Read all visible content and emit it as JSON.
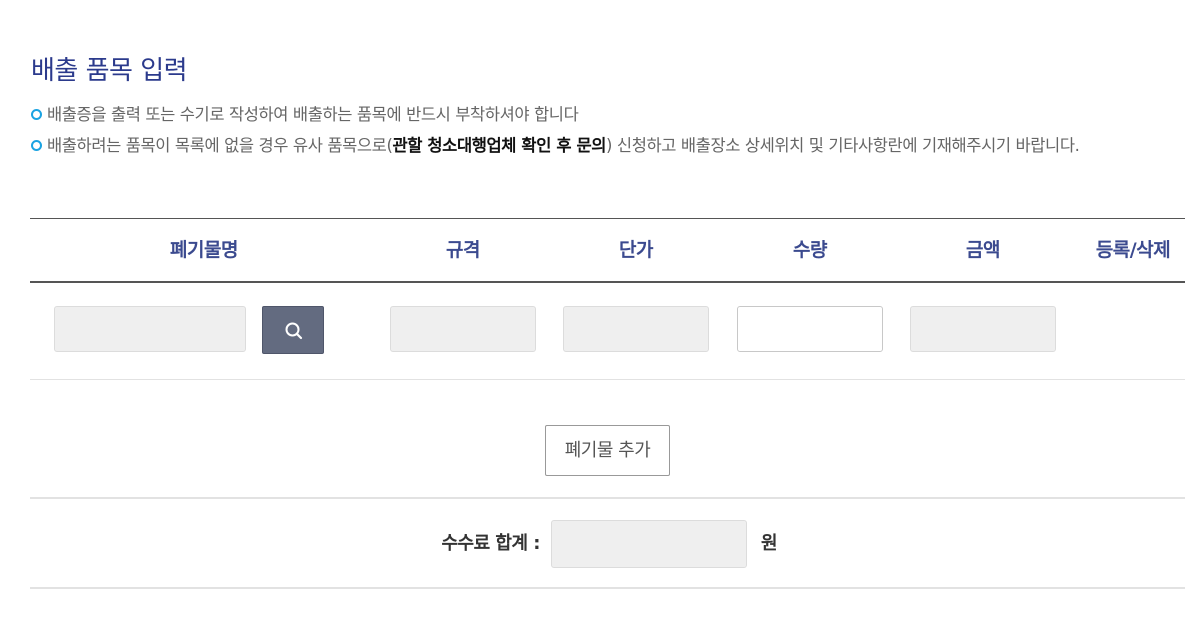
{
  "page": {
    "title": "배출 품목 입력"
  },
  "notices": [
    {
      "text": "배출증을 출력 또는 수기로 작성하여 배출하는 품목에 반드시 부착하셔야 합니다"
    },
    {
      "before": "배출하려는 품목이 목록에 없을 경우 유사 품목으로(",
      "bold": "관할 청소대행업체 확인 후 문의",
      "after": ") 신청하고 배출장소 상세위치 및 기타사항란에 기재해주시기 바랍니다."
    }
  ],
  "table": {
    "headers": {
      "name": "폐기물명",
      "spec": "규격",
      "price": "단가",
      "qty": "수량",
      "amount": "금액",
      "action": "등록/삭제"
    },
    "row": {
      "name": "",
      "spec": "",
      "price": "",
      "qty": "",
      "amount": ""
    }
  },
  "buttons": {
    "add": "폐기물 추가"
  },
  "total": {
    "label": "수수료 합계 :",
    "value": "",
    "unit": "원"
  },
  "icons": {
    "search": "search-icon",
    "bullet": "circle-bullet-icon"
  },
  "colors": {
    "title": "#2b3a8c",
    "header": "#3b4a8f",
    "bullet": "#1aa3e2",
    "search_button": "#636b80"
  }
}
